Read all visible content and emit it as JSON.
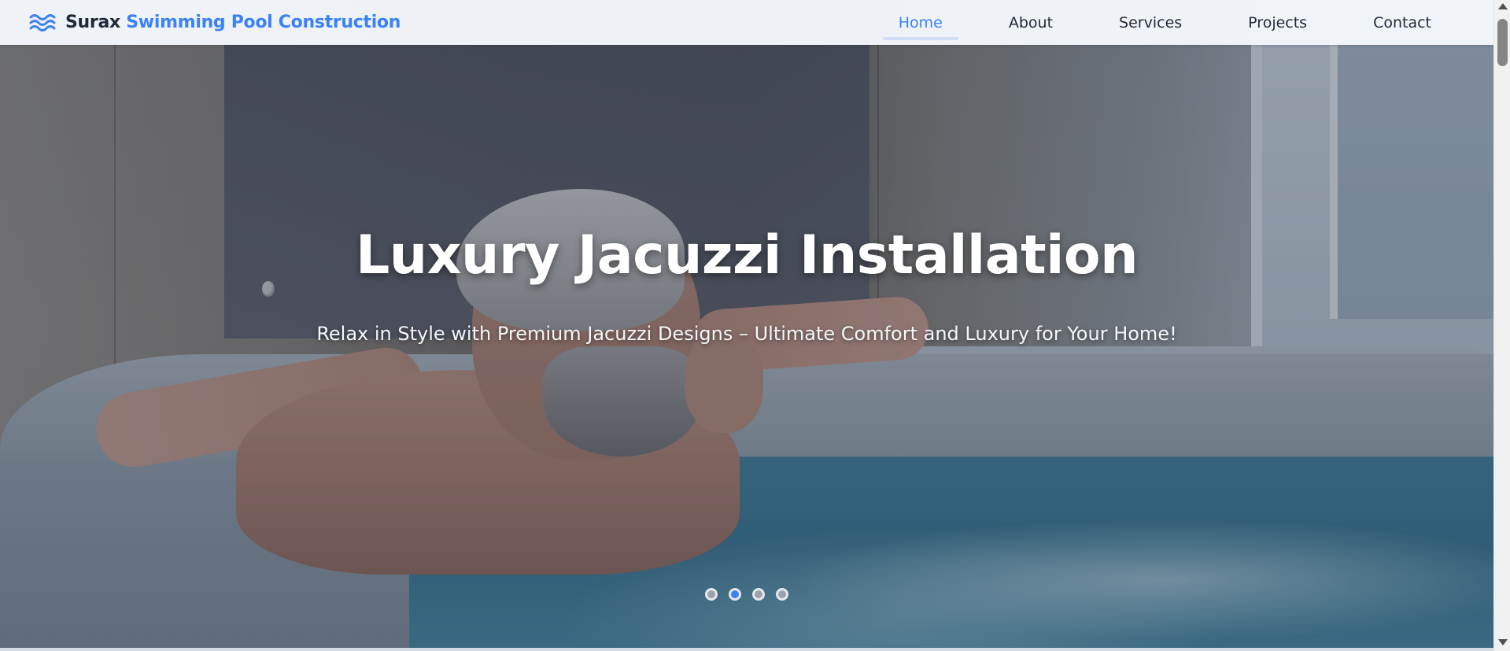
{
  "brand": {
    "icon": "waves-icon",
    "name_primary": "Surax",
    "name_secondary": "Swimming Pool Construction",
    "colors": {
      "dark": "#1f2937",
      "accent": "#3b82f6"
    }
  },
  "nav": {
    "items": [
      {
        "label": "Home",
        "active": true
      },
      {
        "label": "About",
        "active": false
      },
      {
        "label": "Services",
        "active": false
      },
      {
        "label": "Projects",
        "active": false
      },
      {
        "label": "Contact",
        "active": false
      }
    ]
  },
  "hero": {
    "title": "Luxury Jacuzzi Installation",
    "subtitle": "Relax in Style with Premium Jacuzzi Designs – Ultimate Comfort and Luxury for Your Home!",
    "slides_total": 4,
    "active_slide": 2
  },
  "scrollbar": {
    "up_icon": "scroll-up-arrow-icon",
    "down_icon": "scroll-down-arrow-icon"
  }
}
